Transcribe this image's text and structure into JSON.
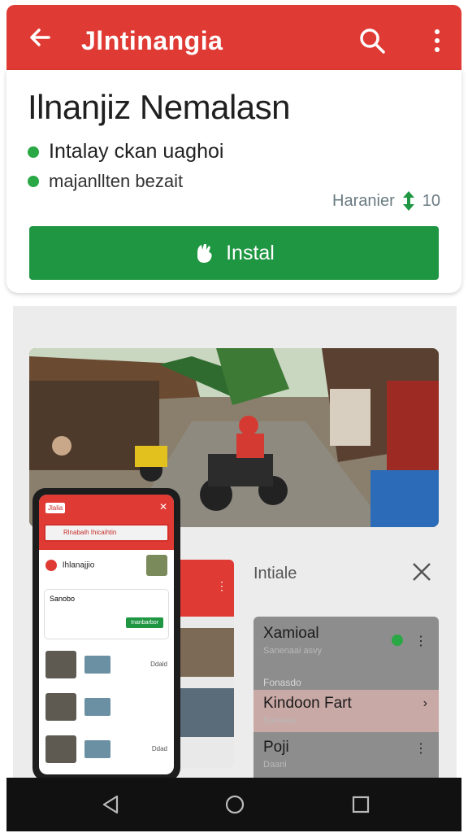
{
  "appbar": {
    "title": "Jlntinangia",
    "back_icon": "arrow-back-icon",
    "search_icon": "search-icon",
    "more_icon": "more-vert-icon",
    "color": "#e03a34"
  },
  "header": {
    "app_name": "Ilnanjiz Nemalasn",
    "bullets": [
      "Intalay ckan uaghoi",
      "majanllten bezait"
    ],
    "rating_label": "Haranier",
    "rating_value": "10",
    "install_label": "Instal",
    "install_color": "#1f9642"
  },
  "phone": {
    "tag": "Jlalia",
    "chip_text": "Rlnabaih Ihicaihtin",
    "app_title": "Ihlanajjio",
    "section": "Sanobo",
    "action": "Inanbarbor",
    "item_labels": [
      "Ddald",
      "Ddad"
    ]
  },
  "panel": {
    "title": "Intiale",
    "close_icon": "close-icon",
    "items": [
      {
        "name": "Xamioal",
        "sub": "Sanenaai asvy"
      },
      {
        "name": "Kindoon Fart",
        "sub": "Sanwaa"
      },
      {
        "name": "Poji",
        "sub": "Daani"
      }
    ],
    "section_label": "Fonasdo"
  },
  "navbar": {
    "back_icon": "nav-back-icon",
    "home_icon": "nav-home-icon",
    "recents_icon": "nav-recents-icon"
  }
}
